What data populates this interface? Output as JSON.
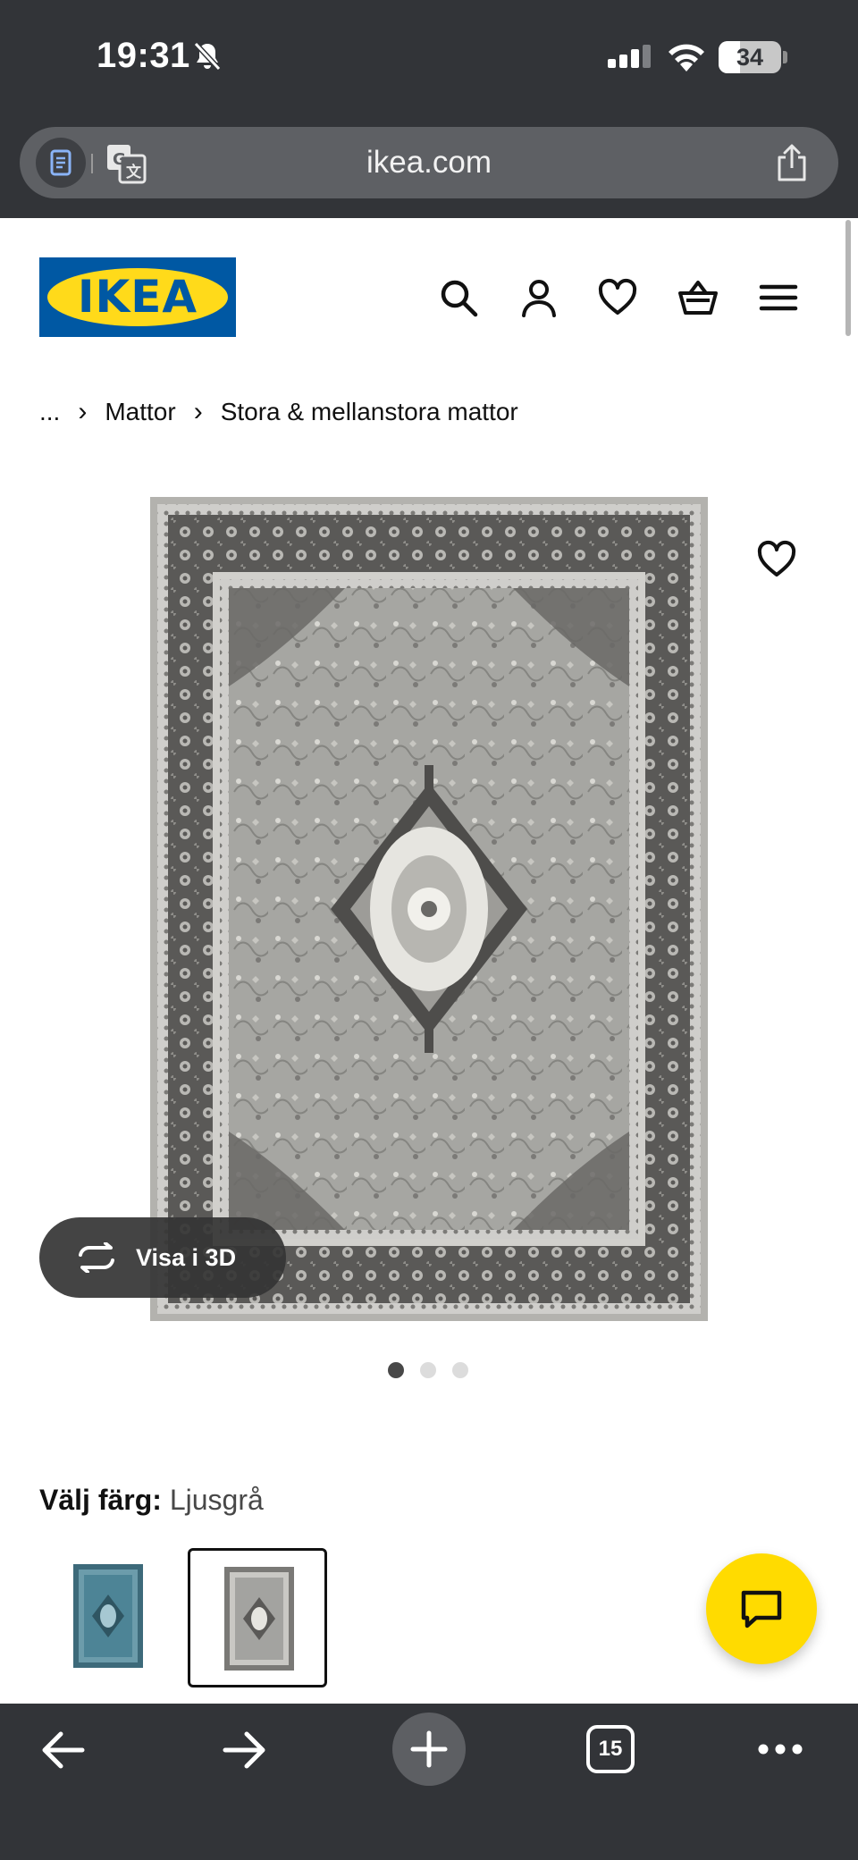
{
  "status_bar": {
    "time": "19:31",
    "battery": "34",
    "battery_level_percent": 34,
    "icons": [
      "bell-slash-icon",
      "cellular-signal-icon",
      "wifi-icon",
      "battery-icon"
    ]
  },
  "browser": {
    "url": "ikea.com",
    "icons": [
      "reader-mode-icon",
      "translate-icon",
      "share-icon"
    ]
  },
  "header": {
    "logo_text": "IKEA",
    "icons": [
      "search-icon",
      "account-icon",
      "favorites-heart-icon",
      "shopping-basket-icon",
      "menu-icon"
    ]
  },
  "breadcrumb": {
    "items": [
      "...",
      "Mattor",
      "Stora & mellanstora mattor"
    ],
    "separator": "›"
  },
  "gallery": {
    "view_3d_label": "Visa i 3D",
    "dot_count": 3,
    "active_dot": 1
  },
  "color_selector": {
    "label": "Välj färg:",
    "selected": "Ljusgrå",
    "swatches": [
      {
        "name": "blue rug thumbnail",
        "color": "#4d8496"
      },
      {
        "name": "light grey rug thumbnail",
        "color": "#a3a3a0",
        "selected": true
      }
    ]
  },
  "toolbar": {
    "tab_count": "15",
    "icons": [
      "back-arrow-icon",
      "forward-arrow-icon",
      "new-tab-plus-icon",
      "tabs-icon",
      "more-icon"
    ]
  },
  "colors": {
    "ikea_blue": "#0058a3",
    "ikea_yellow": "#ffdb00",
    "chrome_dark": "#323438"
  }
}
